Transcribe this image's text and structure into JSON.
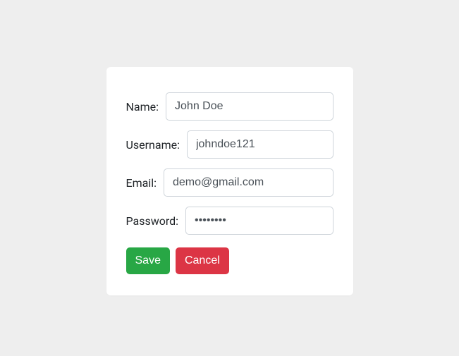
{
  "form": {
    "name": {
      "label": "Name:",
      "value": "John Doe"
    },
    "username": {
      "label": "Username:",
      "value": "johndoe121"
    },
    "email": {
      "label": "Email:",
      "value": "demo@gmail.com"
    },
    "password": {
      "label": "Password:",
      "value": "••••••••"
    }
  },
  "buttons": {
    "save": "Save",
    "cancel": "Cancel"
  }
}
